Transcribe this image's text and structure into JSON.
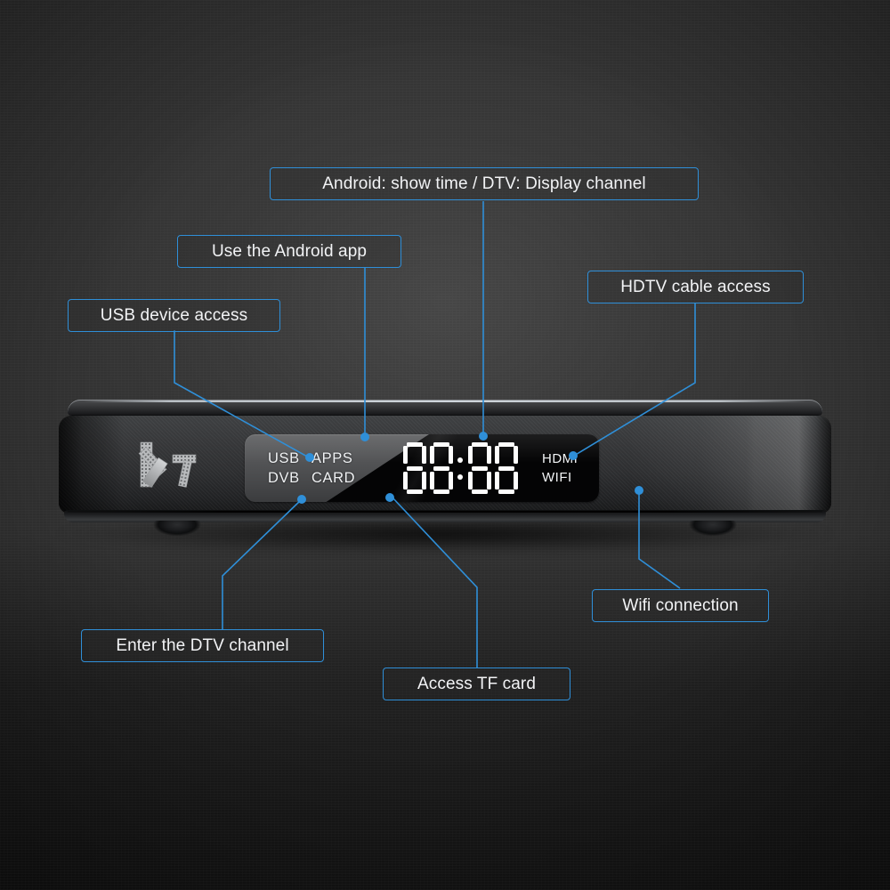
{
  "product": {
    "brand_logo": "K7",
    "body_color": "#2d2e30",
    "accent_color": "#2f8fd8"
  },
  "display_panel": {
    "indicators_left": [
      {
        "row": 0,
        "items": [
          "USB",
          "APPS"
        ]
      },
      {
        "row": 1,
        "items": [
          "DVB",
          "CARD"
        ]
      }
    ],
    "clock": {
      "value": "88:88",
      "digits": [
        "8",
        "8",
        "8",
        "8"
      ],
      "separator": ":",
      "segment_color": "#fdfdfd"
    },
    "indicators_right": [
      "HDMI",
      "WIFI"
    ]
  },
  "callouts": [
    {
      "id": "android-time-dtv-channel",
      "label": "Android: show time / DTV: Display channel"
    },
    {
      "id": "use-android-app",
      "label": "Use the Android app"
    },
    {
      "id": "usb-device-access",
      "label": "USB device access"
    },
    {
      "id": "hdtv-cable-access",
      "label": "HDTV cable access"
    },
    {
      "id": "wifi-connection",
      "label": "Wifi connection"
    },
    {
      "id": "enter-dtv-channel",
      "label": "Enter the DTV channel"
    },
    {
      "id": "access-tf-card",
      "label": "Access TF card"
    }
  ]
}
